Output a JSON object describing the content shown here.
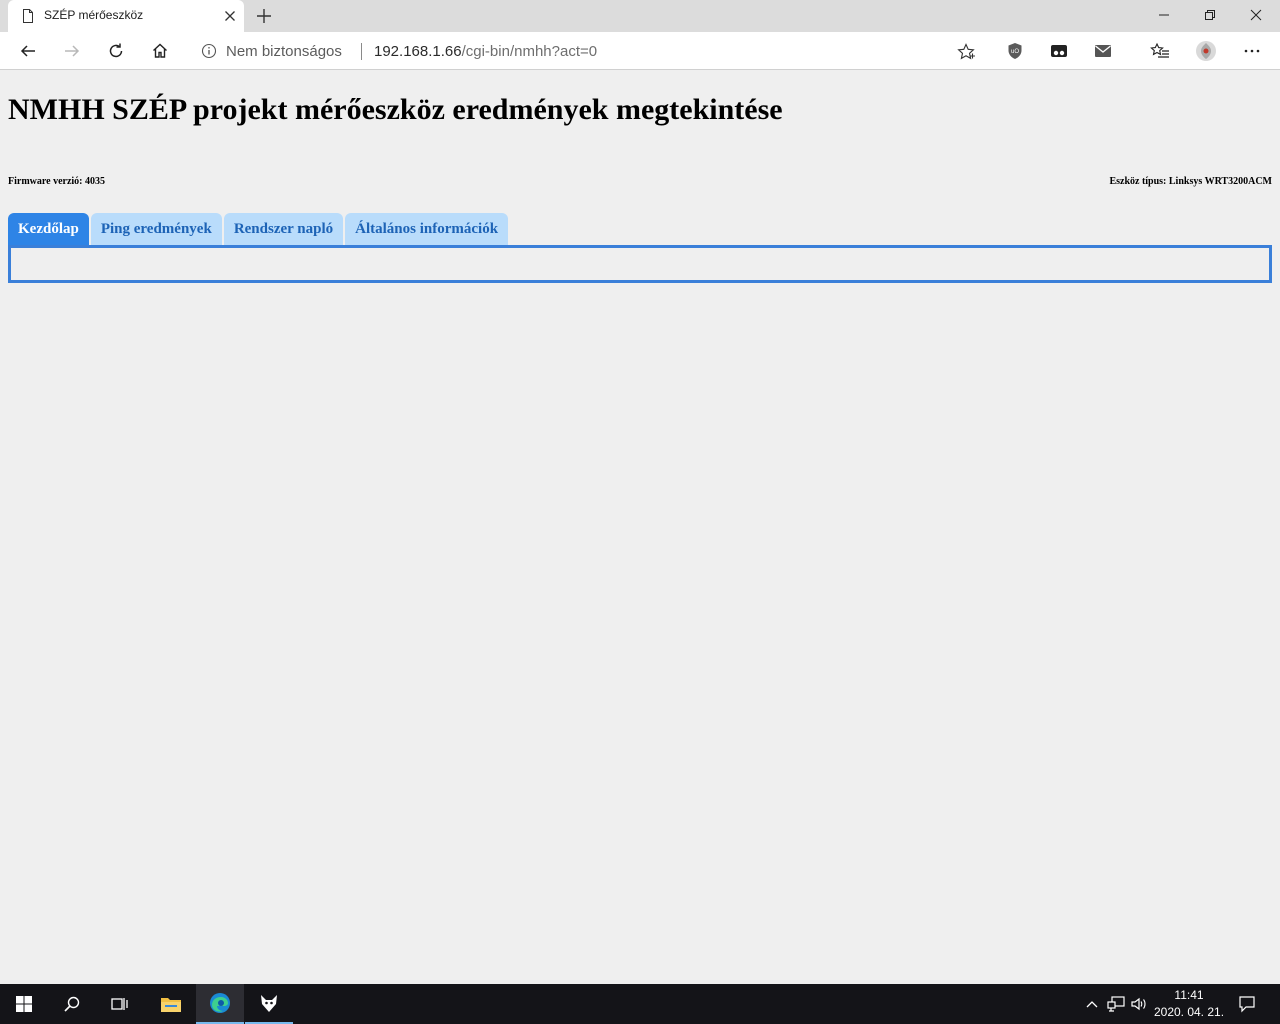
{
  "browser": {
    "tab_title": "SZÉP mérőeszköz",
    "security_label": "Nem biztonságos",
    "url_host": "192.168.1.66",
    "url_path": "/cgi-bin/nmhh?act=0"
  },
  "page": {
    "heading": "NMHH SZÉP projekt mérőeszköz eredmények megtekintése",
    "firmware": "Firmware verzió: 4035",
    "device_type": "Eszköz típus: Linksys WRT3200ACM",
    "tabs": [
      {
        "label": "Kezdőlap",
        "active": true
      },
      {
        "label": "Ping eredmények",
        "active": false
      },
      {
        "label": "Rendszer napló",
        "active": false
      },
      {
        "label": "Általános információk",
        "active": false
      }
    ]
  },
  "taskbar": {
    "time": "11:41",
    "date": "2020. 04. 21."
  },
  "colors": {
    "active_tab": "#2e84e6",
    "inactive_tab": "#b9dcfb",
    "inactive_tab_text": "#1d63b6",
    "panel_border": "#3a7fd9",
    "page_bg": "#efefef"
  }
}
